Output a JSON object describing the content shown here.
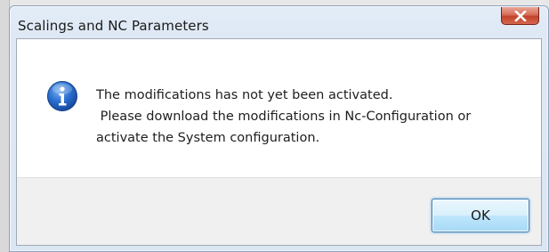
{
  "dialog": {
    "title": "Scalings and NC Parameters",
    "close_icon": "close-icon",
    "message_icon": "info-icon",
    "message_lines": [
      "The modifications has not yet been activated.",
      " Please download the modifications in Nc-Configuration or",
      "activate the System configuration."
    ],
    "ok_label": "OK"
  },
  "colors": {
    "close_button": "#c9543e",
    "ok_button_border": "#3c7fb1",
    "info_icon_blue": "#1f5fbf"
  }
}
